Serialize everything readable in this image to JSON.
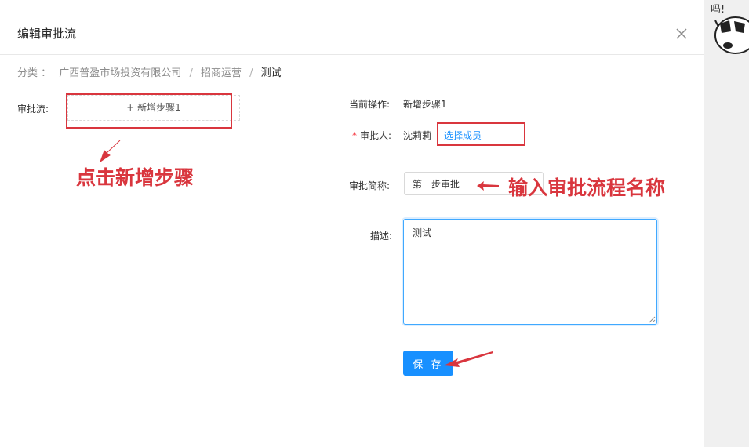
{
  "modal": {
    "title": "编辑审批流"
  },
  "breadcrumb": {
    "category_label": "分类 ：",
    "items": [
      "广西普盈市场投资有限公司",
      "招商运营",
      "测试"
    ],
    "separator": "/"
  },
  "flow": {
    "label": "审批流:",
    "add_step_text": "+ 新增步骤1"
  },
  "form": {
    "current_op_label": "当前操作:",
    "current_op_value": "新增步骤1",
    "approver_label": "审批人:",
    "approver_value": "沈莉莉",
    "select_member_text": "选择成员",
    "short_name_label": "审批简称:",
    "short_name_value": "第一步审批",
    "desc_label": "描述:",
    "desc_value": "测试",
    "save_label": "保 存"
  },
  "annotations": {
    "click_add_step": "点击新增步骤",
    "input_flow_name": "输入审批流程名称"
  },
  "colors": {
    "primary": "#1890ff",
    "annotation": "#d9363e",
    "required": "#f5222d"
  }
}
